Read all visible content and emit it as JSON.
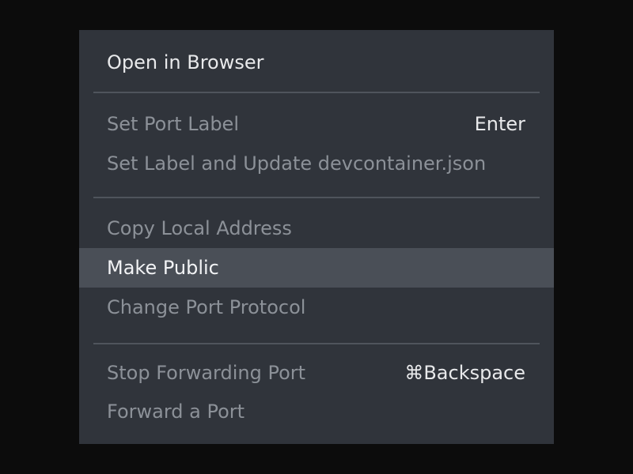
{
  "menu": {
    "items": [
      {
        "label": "Open in Browser",
        "shortcut": ""
      },
      {
        "label": "Set Port Label",
        "shortcut": "Enter"
      },
      {
        "label": "Set Label and Update devcontainer.json",
        "shortcut": ""
      },
      {
        "label": "Copy Local Address",
        "shortcut": ""
      },
      {
        "label": "Make Public",
        "shortcut": ""
      },
      {
        "label": "Change Port Protocol",
        "shortcut": ""
      },
      {
        "label": "Stop Forwarding Port",
        "shortcut": "⌘Backspace"
      },
      {
        "label": "Forward a Port",
        "shortcut": ""
      }
    ],
    "active_item": "Make Public"
  },
  "colors": {
    "backdrop": "#0c0c0c",
    "menu_background": "#30343b",
    "highlight": "#4a4f57",
    "separator": "#4f545c",
    "text_enabled": "#e8e9eb",
    "text_dimmed": "#8c9198"
  }
}
